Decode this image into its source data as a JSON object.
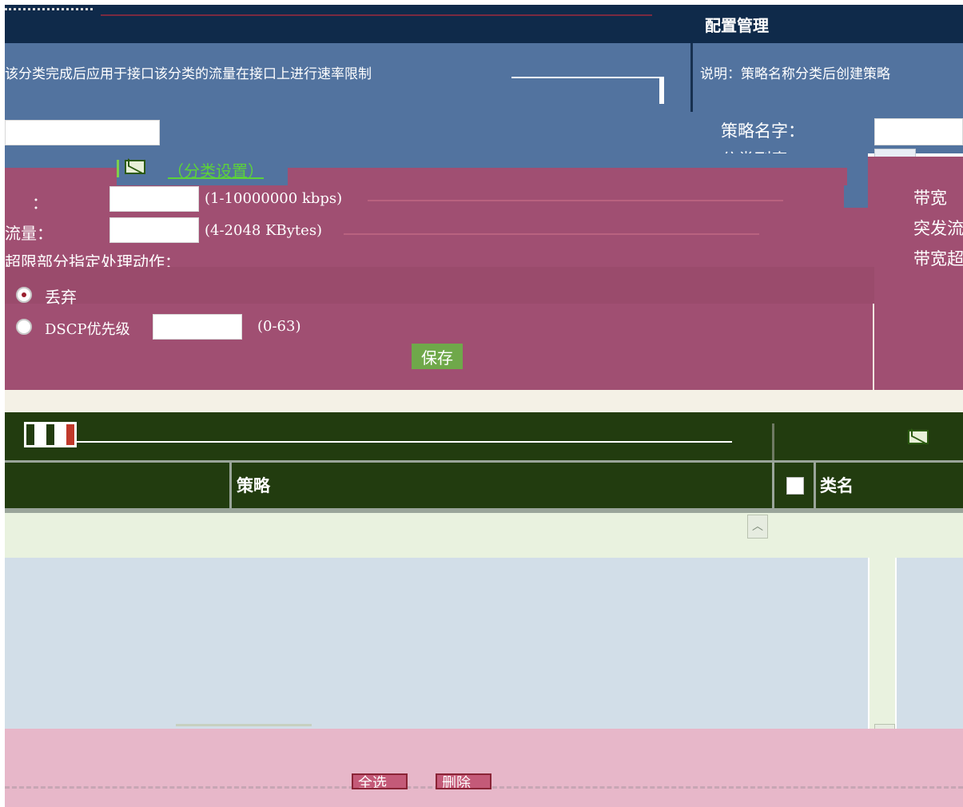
{
  "colors": {
    "navy": "#0f2a4a",
    "steel_blue": "#52739f",
    "maroon": "#a04f72",
    "dark_green": "#223c0f",
    "pale_green": "#e9f2df",
    "light_blue_grey": "#d2dee8",
    "pink": "#e7b7c9",
    "save_button": "#6fa84a"
  },
  "header": {
    "title_right": "配置管理",
    "desc_left": "该分类完成后应用于接口该分类的流量在接口上进行速率限制",
    "desc_right": "说明：策略名称分类后创建策略"
  },
  "policy_form": {
    "policy_name_label": "策略名字：",
    "classify_label": "分类列表：",
    "classify_link": "（分类设置）"
  },
  "rate_form": {
    "bandwidth_label": "：",
    "bandwidth_range": "(1-10000000 kbps)",
    "burst_label": "流量：",
    "burst_range": "(4-2048 KBytes)",
    "exceed_action_label": "超限部分指定处理动作：",
    "action_drop_label": "丢弃",
    "action_dscp_label": "DSCP优先级",
    "dscp_range": "(0-63)",
    "save_label": "保存",
    "right_labels": [
      "带宽",
      "突发流",
      "带宽超"
    ],
    "action_selected": "drop"
  },
  "table": {
    "col_policy": "策略",
    "col_class": "类名"
  },
  "footer": {
    "select_all_label": "全选",
    "delete_label": "删除"
  },
  "icons": {
    "mail": "mail-icon",
    "grid": "grid-icon",
    "scroll_up": "scroll-up-arrow-icon",
    "scroll_down": "scroll-down-arrow-icon"
  }
}
